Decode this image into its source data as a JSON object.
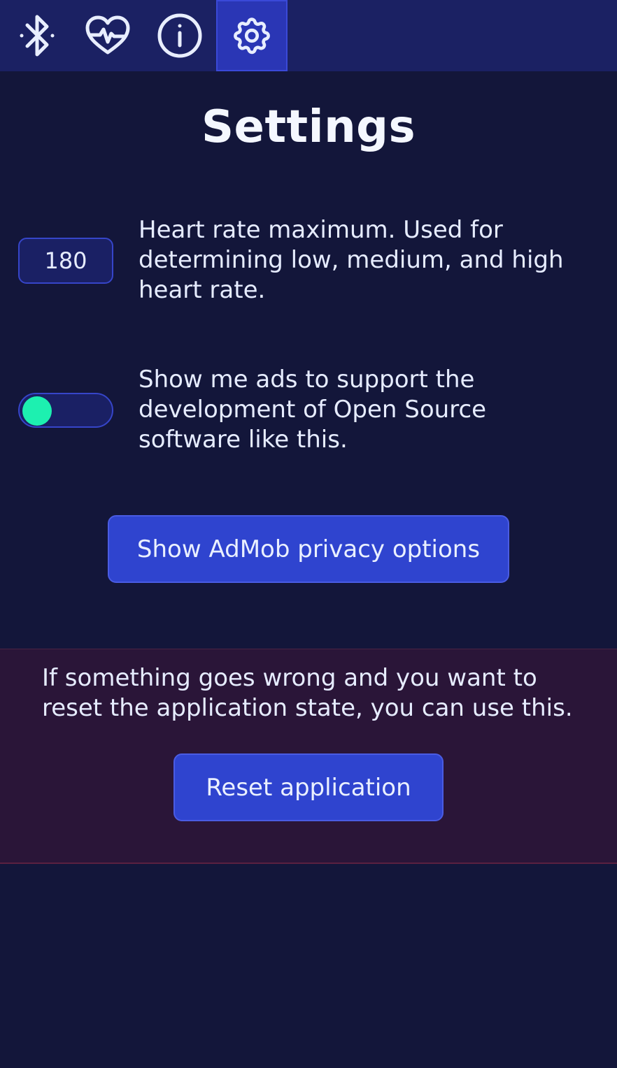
{
  "nav": {
    "tabs": [
      {
        "name": "bluetooth",
        "icon": "bluetooth-icon",
        "active": false
      },
      {
        "name": "heart-rate",
        "icon": "heart-pulse-icon",
        "active": false
      },
      {
        "name": "info",
        "icon": "info-icon",
        "active": false
      },
      {
        "name": "settings",
        "icon": "gear-icon",
        "active": true
      }
    ]
  },
  "page": {
    "title": "Settings"
  },
  "heart_rate_max": {
    "value": "180",
    "description": "Heart rate maximum. Used for determining low, medium, and high heart rate."
  },
  "ads": {
    "enabled": false,
    "description": "Show me ads to support the development of Open Source software like this."
  },
  "admob_button": {
    "label": "Show AdMob privacy options"
  },
  "reset": {
    "description": "If something goes wrong and you want to reset the application state, you can use this.",
    "button_label": "Reset application"
  },
  "colors": {
    "background": "#13163a",
    "topbar": "#1b2163",
    "accent": "#2f44cf",
    "toggle_knob": "#1df0b0",
    "danger_zone": "#2a1538"
  }
}
